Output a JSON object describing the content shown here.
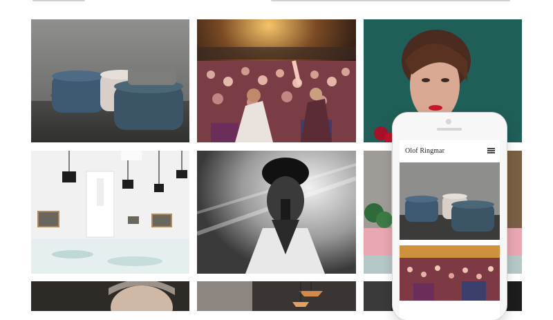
{
  "page": {
    "background": "#ffffff"
  },
  "grid": {
    "tiles": [
      {
        "id": "furniture-ottomans",
        "subject": "studio-with-poufs"
      },
      {
        "id": "concert-crowd",
        "subject": "concert-crowd"
      },
      {
        "id": "woman-portrait",
        "subject": "woman-portrait-red-lips"
      },
      {
        "id": "gallery-interior",
        "subject": "white-gallery-room"
      },
      {
        "id": "singer-bw",
        "subject": "singer-with-microphone"
      },
      {
        "id": "red-plants-balcony",
        "subject": "balcony-with-plants"
      },
      {
        "id": "man-portrait",
        "subject": "man-portrait"
      },
      {
        "id": "restaurant-lamps",
        "subject": "pendant-lamps"
      },
      {
        "id": "dark-interior",
        "subject": "dark-room"
      }
    ]
  },
  "phone": {
    "site_title": "Olof Ringmar",
    "menu_icon": "hamburger-menu-icon",
    "images": [
      "studio-with-poufs",
      "concert-crowd"
    ]
  }
}
